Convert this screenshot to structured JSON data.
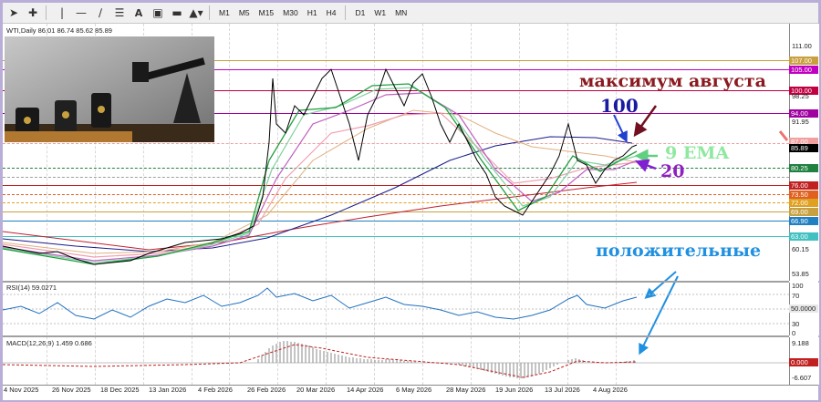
{
  "toolbar": {
    "timeframes": [
      "M1",
      "M5",
      "M15",
      "M30",
      "H1",
      "H4",
      "D1",
      "W1",
      "MN"
    ]
  },
  "header": {
    "instrument": "WTI,Daily",
    "ohlc": "86.01 86.74 85.62 85.89"
  },
  "price_scale": [
    "111.00",
    "105.00",
    "100.00",
    "98.25",
    "94.00",
    "91.95",
    "85.89",
    "80.25",
    "76.00",
    "73.50",
    "72.00",
    "69.00",
    "66.90",
    "63.00",
    "60.15",
    "53.85"
  ],
  "price_levels": [
    {
      "label": "107.00",
      "color": "#c8a040"
    },
    {
      "label": "105.00",
      "color": "#c000c0"
    },
    {
      "label": "100.00",
      "color": "#c00040"
    },
    {
      "label": "94.00",
      "color": "#a000a0"
    },
    {
      "label": "87.00",
      "color": "#f0a0a0"
    },
    {
      "label": "80.25",
      "color": "#208040"
    },
    {
      "label": "76.00",
      "color": "#c02020"
    },
    {
      "label": "73.50",
      "color": "#e06020"
    },
    {
      "label": "72.00",
      "color": "#e0a020"
    },
    {
      "label": "69.00",
      "color": "#c8a040"
    },
    {
      "label": "66.90",
      "color": "#2080c0"
    },
    {
      "label": "63.00",
      "color": "#40c0c0"
    }
  ],
  "current_price": "85.89",
  "annotations": {
    "august_high": "максимум августа",
    "label_100": "100",
    "label_9ema": "9 EMA",
    "label_20": "20",
    "positive": "положительные"
  },
  "rsi": {
    "header": "RSI(14) 59.0271",
    "scale": [
      "100",
      "70",
      "50.0000",
      "30",
      "0"
    ]
  },
  "macd": {
    "header": "MACD(12,26,9) 1.459 0.686",
    "scale": [
      "9.188",
      "0.000",
      "-6.607"
    ]
  },
  "dates": [
    "4 Nov 2025",
    "26 Nov 2025",
    "18 Dec 2025",
    "13 Jan 2026",
    "4 Feb 2026",
    "26 Feb 2026",
    "20 Mar 2026",
    "14 Apr 2026",
    "6 May 2026",
    "28 May 2026",
    "19 Jun 2026",
    "13 Jul 2026",
    "4 Aug 2026"
  ],
  "colors": {
    "candle": "#000000",
    "ema9": "#20a040",
    "ema20": "#c060c0",
    "ma100": "#1a1a8a",
    "ma200": "#c02030"
  }
}
